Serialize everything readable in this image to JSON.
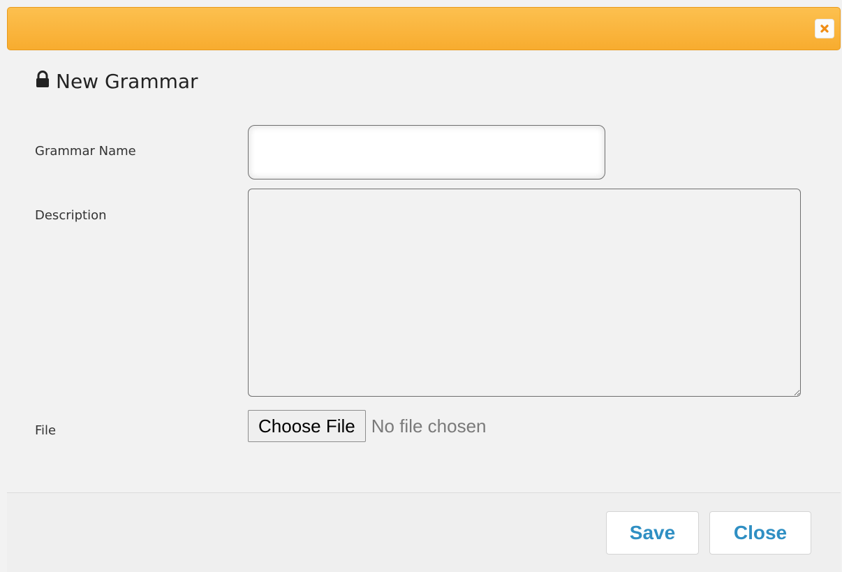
{
  "dialog": {
    "title": "New Grammar",
    "accent_color": "#f9b43a",
    "close_icon": "close-icon"
  },
  "form": {
    "grammar_name": {
      "label": "Grammar Name",
      "value": "",
      "placeholder": ""
    },
    "description": {
      "label": "Description",
      "value": "",
      "placeholder": ""
    },
    "file": {
      "label": "File",
      "button_label": "Choose File",
      "status": "No file chosen"
    }
  },
  "footer": {
    "save_label": "Save",
    "close_label": "Close",
    "button_text_color": "#2f8fc3"
  }
}
